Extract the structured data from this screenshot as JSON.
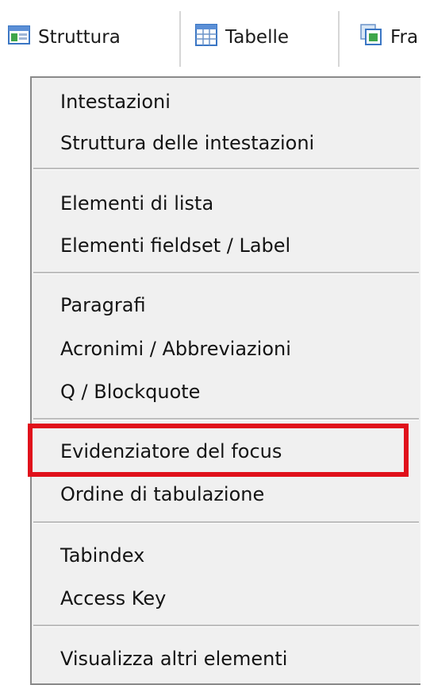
{
  "toolbar": {
    "items": [
      {
        "label": "Struttura",
        "icon": "structure-icon"
      },
      {
        "label": "Tabelle",
        "icon": "table-icon"
      },
      {
        "label": "Fra",
        "icon": "frames-icon"
      }
    ]
  },
  "menu": {
    "groups": [
      [
        "Intestazioni",
        "Struttura delle intestazioni"
      ],
      [
        "Elementi di lista",
        "Elementi fieldset / Label"
      ],
      [
        "Paragrafi",
        "Acronimi / Abbreviazioni",
        "Q / Blockquote"
      ],
      [
        "Evidenziatore del focus",
        "Ordine di tabulazione"
      ],
      [
        "Tabindex",
        "Access Key"
      ],
      [
        "Visualizza altri elementi"
      ]
    ]
  },
  "highlight": {
    "target": "Evidenziatore del focus",
    "color": "#e0111b"
  },
  "colors": {
    "menu_background": "#f0f0f0",
    "separator": "#bdbdbd",
    "toolbar_icon_blue": "#3a76c4",
    "toolbar_icon_green": "#3fa64a"
  }
}
